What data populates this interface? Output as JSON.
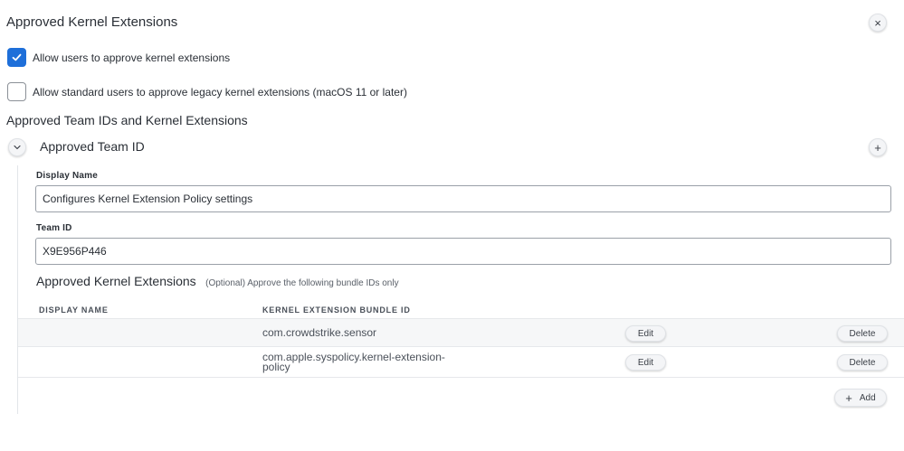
{
  "header": {
    "title": "Approved Kernel Extensions",
    "close_glyph": "×"
  },
  "options": {
    "allow_users": {
      "label": "Allow users to approve kernel extensions",
      "checked": true
    },
    "allow_standard": {
      "label": "Allow standard users to approve legacy kernel extensions (macOS 11 or later)",
      "checked": false
    }
  },
  "team_section": {
    "title": "Approved Team IDs and Kernel Extensions",
    "group_title": "Approved Team ID",
    "add_glyph": "+",
    "collapse_glyph": "⌄"
  },
  "form": {
    "display_name_label": "Display Name",
    "display_name_value": "Configures Kernel Extension Policy settings",
    "team_id_label": "Team ID",
    "team_id_value": "X9E956P446"
  },
  "extensions": {
    "title": "Approved Kernel Extensions",
    "hint": "(Optional) Approve the following bundle IDs only",
    "columns": [
      "DISPLAY NAME",
      "KERNEL EXTENSION BUNDLE ID"
    ],
    "rows": [
      {
        "display_name": "",
        "bundle_id_line1": "com.crowdstrike.sensor",
        "bundle_id_line2": "",
        "edit_label": "Edit",
        "delete_label": "Delete"
      },
      {
        "display_name": "",
        "bundle_id_line1": "com.apple.syspolicy.kernel-extension-",
        "bundle_id_line2": "policy",
        "edit_label": "Edit",
        "delete_label": "Delete"
      }
    ],
    "add_label": "Add",
    "add_glyph": "+"
  },
  "colors": {
    "accent": "#1e6fd9",
    "row_shade": "#f6f7f8",
    "border": "#9aa0a8"
  }
}
